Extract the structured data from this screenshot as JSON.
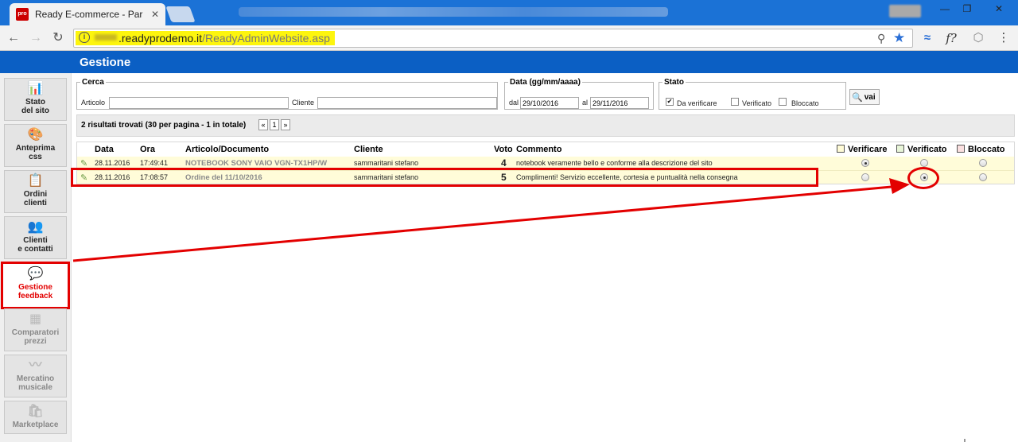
{
  "browser": {
    "tab_title": "Ready E-commerce - Par",
    "favicon_text": "pro",
    "url_host": ".readyprodemo.it",
    "url_path": "/ReadyAdminWebsite.asp",
    "win_min": "—",
    "win_max": "❐",
    "win_close": "✕"
  },
  "app": {
    "title": "Gestione"
  },
  "sidebar": {
    "items": [
      {
        "icon": "📊",
        "label_1": "Stato",
        "label_2": "del sito"
      },
      {
        "icon": "🎨",
        "label_1": "Anteprima",
        "label_2": "css"
      },
      {
        "icon": "📋",
        "label_1": "Ordini",
        "label_2": "clienti"
      },
      {
        "icon": "👥",
        "label_1": "Clienti",
        "label_2": "e contatti"
      },
      {
        "icon": "💬",
        "label_1": "Gestione",
        "label_2": "feedback"
      },
      {
        "icon": "▦",
        "label_1": "Comparatori",
        "label_2": "prezzi"
      },
      {
        "icon": "〰",
        "label_1": "Mercatino",
        "label_2": "musicale"
      },
      {
        "icon": "🛍",
        "label_1": "Marketplace",
        "label_2": ""
      }
    ]
  },
  "filters": {
    "cerca_legend": "Cerca",
    "articolo_label": "Articolo",
    "articolo_value": "",
    "cliente_label": "Cliente",
    "cliente_value": "",
    "data_legend": "Data (gg/mm/aaaa)",
    "dal_label": "dal",
    "dal_value": "29/10/2016",
    "al_label": "al",
    "al_value": "29/11/2016",
    "stato_legend": "Stato",
    "da_verificare_label": "Da verificare",
    "da_verificare_checked": "✔",
    "verificato_label": "Verificato",
    "bloccato_label": "Bloccato",
    "vai_label": "vai"
  },
  "results": {
    "summary": "2 risultati trovati (30 per pagina - 1 in totale)",
    "pager_prev": "«",
    "pager_page": "1",
    "pager_next": "»"
  },
  "table": {
    "headers": {
      "data": "Data",
      "ora": "Ora",
      "articolo": "Articolo/Documento",
      "cliente": "Cliente",
      "voto": "Voto",
      "commento": "Commento",
      "verificare": "Verificare",
      "verificato": "Verificato",
      "bloccato": "Bloccato"
    },
    "rows": [
      {
        "data": "28.11.2016",
        "ora": "17:49:41",
        "articolo": "NOTEBOOK SONY VAIO VGN-TX1HP/W",
        "cliente": "sammaritani stefano",
        "voto": "4",
        "commento": "notebook veramente bello e conforme alla descrizione del sito",
        "state": "verificare"
      },
      {
        "data": "28.11.2016",
        "ora": "17:08:57",
        "articolo": "Ordine del 11/10/2016",
        "cliente": "sammaritani stefano",
        "voto": "5",
        "commento": "Complimenti! Servizio eccellente, cortesia e puntualità nella consegna",
        "state": "verificato"
      }
    ]
  },
  "colors": {
    "brand_blue": "#0b5fc4",
    "annotation_red": "#e30000",
    "row_yellow": "#fffcd9"
  }
}
